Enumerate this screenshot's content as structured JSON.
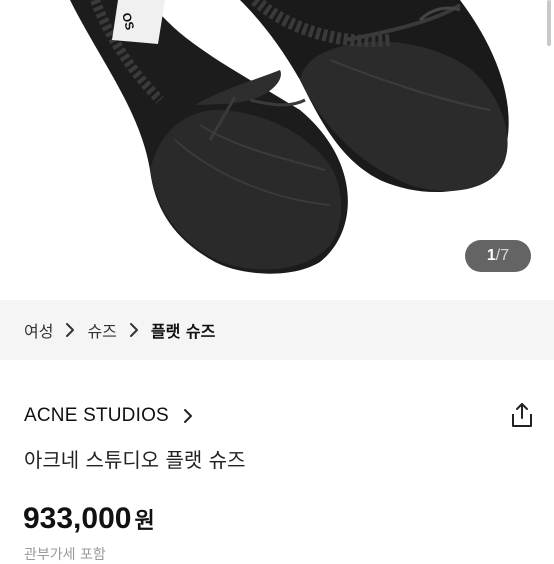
{
  "gallery": {
    "current": "1",
    "separator": "/",
    "total": "7",
    "image_alt": "black ballet flat shoes with bow",
    "label_text": "OS"
  },
  "breadcrumb": {
    "items": [
      {
        "label": "여성"
      },
      {
        "label": "슈즈"
      },
      {
        "label": "플랫 슈즈"
      }
    ]
  },
  "product": {
    "brand": "ACNE STUDIOS",
    "name": "아크네 스튜디오 플랫 슈즈",
    "price": "933,000",
    "currency": "원",
    "tax_note": "관부가세 포함"
  },
  "icons": {
    "chevron": "chevron-right-icon",
    "share": "share-icon"
  }
}
